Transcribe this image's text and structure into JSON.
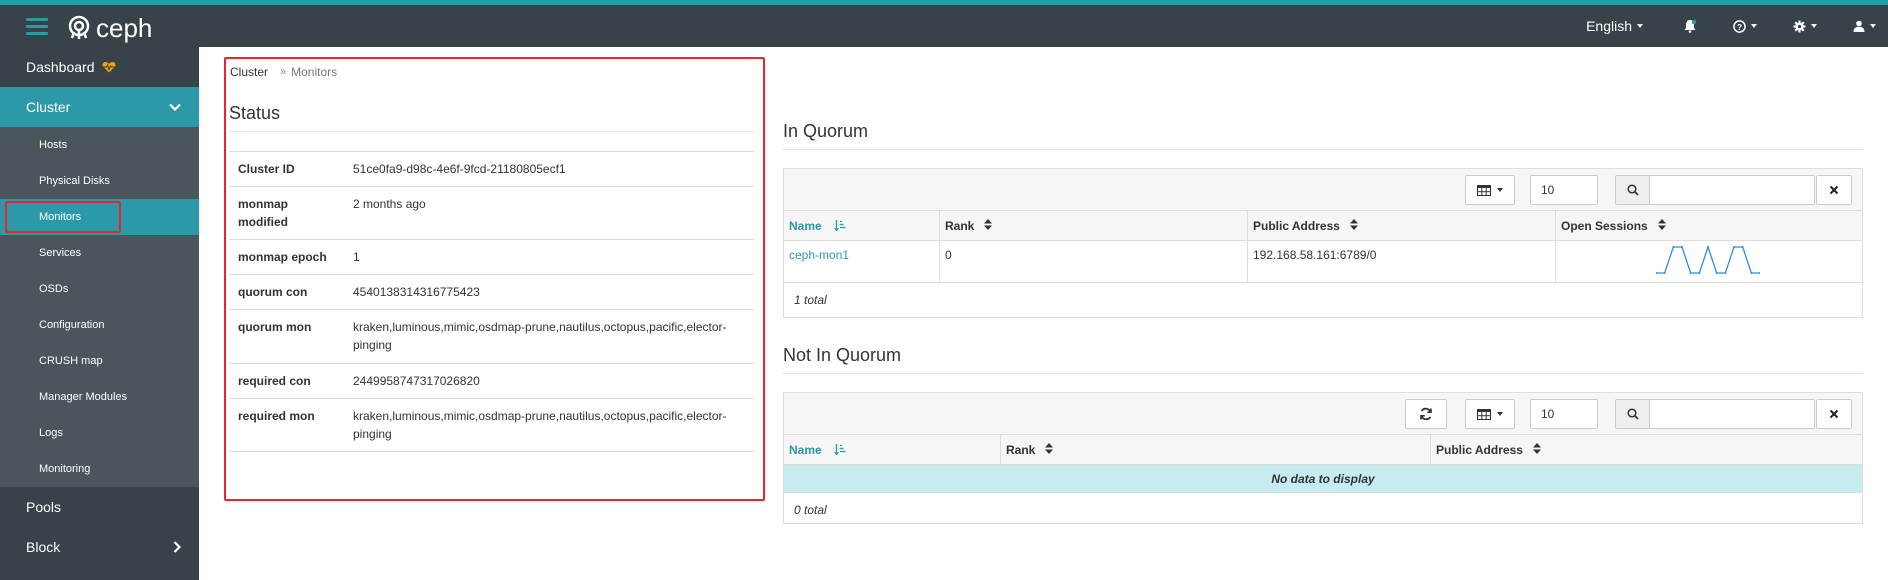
{
  "app": {
    "logo_text": "ceph"
  },
  "topnav": {
    "language": "English"
  },
  "sidebar": {
    "dashboard": "Dashboard",
    "cluster": "Cluster",
    "items": [
      "Hosts",
      "Physical Disks",
      "Monitors",
      "Services",
      "OSDs",
      "Configuration",
      "CRUSH map",
      "Manager Modules",
      "Logs",
      "Monitoring"
    ],
    "pools": "Pools",
    "block": "Block"
  },
  "breadcrumb": {
    "home": "Cluster",
    "current": "Monitors"
  },
  "status": {
    "title": "Status",
    "rows": [
      {
        "key": "Cluster ID",
        "value": "51ce0fa9-d98c-4e6f-9fcd-21180805ecf1"
      },
      {
        "key": "monmap modified",
        "value": "2 months ago"
      },
      {
        "key": "monmap epoch",
        "value": "1"
      },
      {
        "key": "quorum con",
        "value": "4540138314316775423"
      },
      {
        "key": "quorum mon",
        "value": "kraken,luminous,mimic,osdmap-prune,nautilus,octopus,pacific,elector-pinging"
      },
      {
        "key": "required con",
        "value": "2449958747317026820"
      },
      {
        "key": "required mon",
        "value": "kraken,luminous,mimic,osdmap-prune,nautilus,octopus,pacific,elector-pinging"
      }
    ]
  },
  "in_quorum": {
    "title": "In Quorum",
    "limit": "10",
    "columns": [
      "Name",
      "Rank",
      "Public Address",
      "Open Sessions"
    ],
    "rows": [
      {
        "name": "ceph-mon1",
        "rank": "0",
        "public_address": "192.168.58.161:6789/0",
        "open_sessions": [
          0,
          0,
          1,
          1,
          0,
          0,
          1,
          0,
          0,
          1,
          1,
          0,
          0
        ]
      }
    ],
    "total": "1 total"
  },
  "not_in_quorum": {
    "title": "Not In Quorum",
    "limit": "10",
    "columns": [
      "Name",
      "Rank",
      "Public Address"
    ],
    "empty_text": "No data to display",
    "total": "0 total"
  },
  "colors": {
    "accent": "#2b99a8",
    "nav_bg": "#374249",
    "highlight": "#e5262b",
    "empty_row": "#c6ecf0",
    "sparkline": "#2f8ee0"
  }
}
